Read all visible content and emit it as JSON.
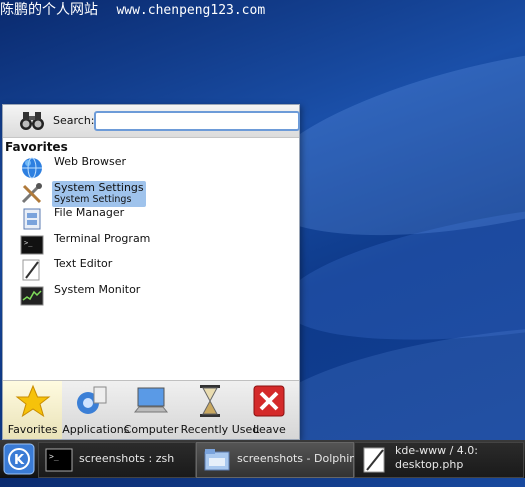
{
  "watermark": {
    "site_name": "陈鹏的个人网站",
    "url": "www.chenpeng123.com"
  },
  "menu": {
    "search": {
      "label": "Search:",
      "value": ""
    },
    "favorites": {
      "title": "Favorites",
      "items": [
        {
          "label": "Web Browser",
          "sublabel": "",
          "icon": "globe-icon"
        },
        {
          "label": "System Settings",
          "sublabel": "System Settings",
          "icon": "tools-icon",
          "selected": true
        },
        {
          "label": "File Manager",
          "sublabel": "",
          "icon": "file-manager-icon"
        },
        {
          "label": "Terminal Program",
          "sublabel": "",
          "icon": "terminal-icon"
        },
        {
          "label": "Text Editor",
          "sublabel": "",
          "icon": "text-editor-icon"
        },
        {
          "label": "System Monitor",
          "sublabel": "",
          "icon": "system-monitor-icon"
        }
      ]
    },
    "tabs": [
      {
        "label": "Favorites",
        "icon": "star-icon",
        "active": true
      },
      {
        "label": "Applications",
        "icon": "applications-icon",
        "active": false
      },
      {
        "label": "Computer",
        "icon": "computer-icon",
        "active": false
      },
      {
        "label": "Recently Used",
        "icon": "hourglass-icon",
        "active": false
      },
      {
        "label": "Leave",
        "icon": "leave-icon",
        "active": false
      }
    ]
  },
  "taskbar": {
    "tasks": [
      {
        "label": "screenshots : zsh",
        "icon": "terminal-icon"
      },
      {
        "label": "screenshots - Dolphin",
        "icon": "folder-icon"
      },
      {
        "label": "kde-www / 4.0: desktop.php",
        "line1": "kde-www / 4.0:",
        "line2": "desktop.php",
        "icon": "text-editor-icon"
      }
    ]
  },
  "colors": {
    "selection": "#9fc3ec",
    "search_border": "#6d9bd8",
    "wallpaper": "#1a4fa8",
    "taskbar": "#222222"
  }
}
